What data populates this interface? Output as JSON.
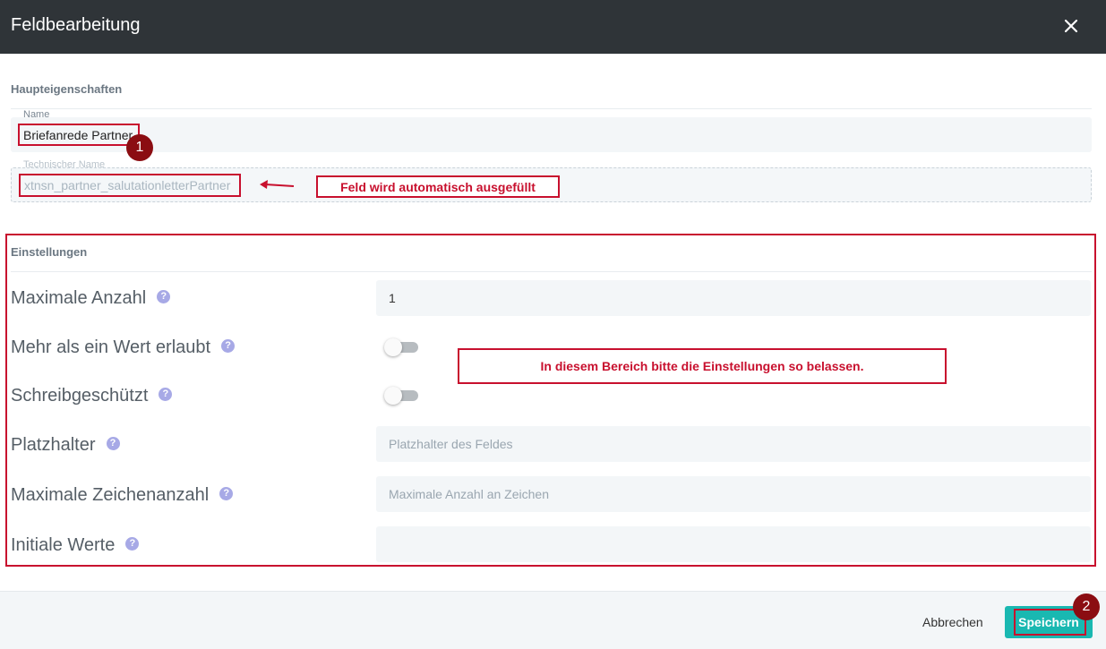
{
  "dialog": {
    "title": "Feldbearbeitung"
  },
  "main_properties": {
    "heading": "Haupteigenschaften",
    "name_label": "Name",
    "name_value": "Briefanrede Partner",
    "technical_name_label": "Technischer Name",
    "technical_name_value": "xtnsn_partner_salutationletterPartner"
  },
  "settings": {
    "heading": "Einstellungen",
    "max_count": {
      "label": "Maximale Anzahl",
      "value": "1"
    },
    "multiple_values": {
      "label": "Mehr als ein Wert erlaubt",
      "enabled": false
    },
    "read_only": {
      "label": "Schreibgeschützt",
      "enabled": false
    },
    "placeholder": {
      "label": "Platzhalter",
      "placeholder": "Platzhalter des Feldes"
    },
    "max_chars": {
      "label": "Maximale Zeichenanzahl",
      "placeholder": "Maximale Anzahl an Zeichen"
    },
    "initial_values": {
      "label": "Initiale Werte",
      "value": ""
    },
    "help_glyph": "?"
  },
  "annotations": {
    "auto_filled": "Feld wird automatisch ausgefüllt",
    "keep_settings": "In diesem Bereich bitte die Einstellungen so belassen.",
    "badge_1": "1",
    "badge_2": "2",
    "color": "#c8102e",
    "badge_color": "#8b0d12"
  },
  "footer": {
    "cancel_label": "Abbrechen",
    "save_label": "Speichern",
    "save_color": "#19b8b1"
  }
}
